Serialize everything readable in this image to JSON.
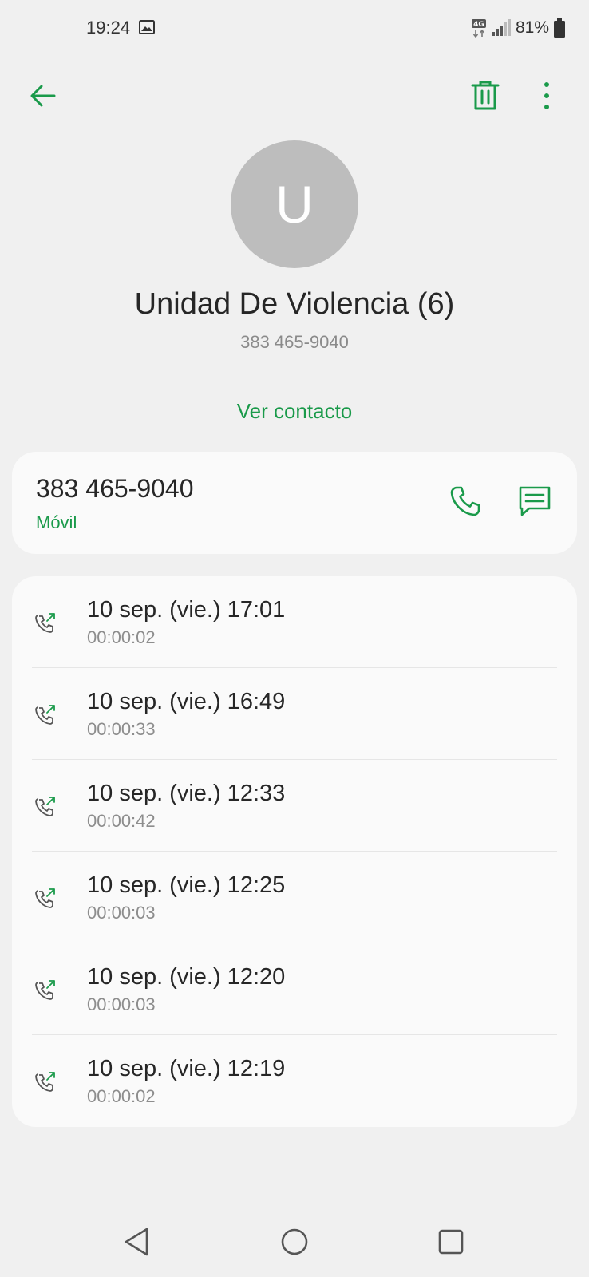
{
  "status_bar": {
    "time": "19:24",
    "network": "4G",
    "battery": "81%",
    "icons": [
      "gallery-icon",
      "network-4g-icon",
      "signal-icon",
      "battery-icon"
    ]
  },
  "app_bar": {
    "icons": [
      "arrow-back-icon",
      "trash-icon",
      "more-vert-icon"
    ]
  },
  "contact": {
    "avatar_letter": "U",
    "avatar_color": "#bdbdbd",
    "name": "Unidad De Violencia (6)",
    "number": "383 465-9040",
    "view_contact_label": "Ver contacto"
  },
  "number_card": {
    "number": "383 465-9040",
    "type": "Móvil",
    "icons": [
      "phone-icon",
      "message-icon"
    ]
  },
  "call_log": [
    {
      "date": "10 sep. (vie.) 17:01",
      "duration": "00:00:02",
      "icon": "outgoing-call-icon"
    },
    {
      "date": "10 sep. (vie.) 16:49",
      "duration": "00:00:33",
      "icon": "outgoing-call-icon"
    },
    {
      "date": "10 sep. (vie.) 12:33",
      "duration": "00:00:42",
      "icon": "outgoing-call-icon"
    },
    {
      "date": "10 sep. (vie.) 12:25",
      "duration": "00:00:03",
      "icon": "outgoing-call-icon"
    },
    {
      "date": "10 sep. (vie.) 12:20",
      "duration": "00:00:03",
      "icon": "outgoing-call-icon"
    },
    {
      "date": "10 sep. (vie.) 12:19",
      "duration": "00:00:02",
      "icon": "outgoing-call-icon"
    }
  ],
  "nav_bar": {
    "icons": [
      "nav-back-icon",
      "nav-home-icon",
      "nav-recents-icon"
    ]
  },
  "colors": {
    "accent": "#1a9a4a",
    "background": "#f0f0f0",
    "card": "#fafafa"
  }
}
